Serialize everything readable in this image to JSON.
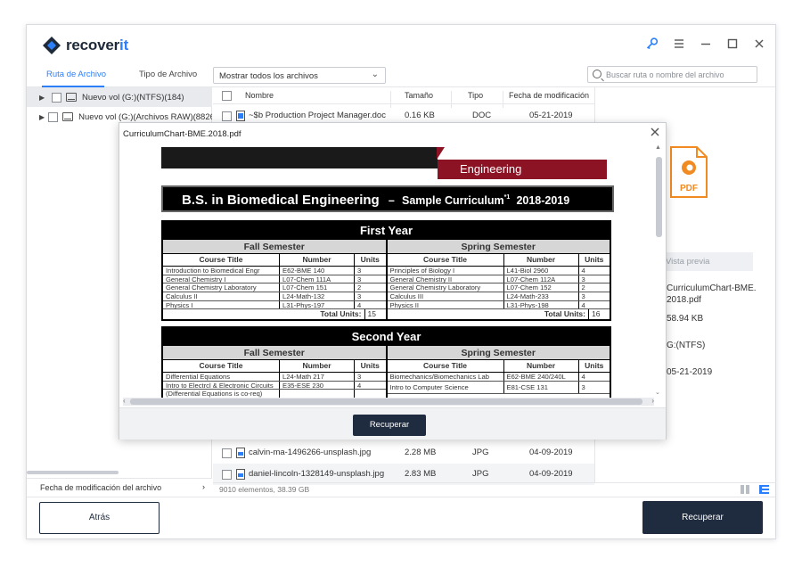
{
  "app": {
    "brand_prefix": "recover",
    "brand_suffix": "it"
  },
  "window_controls": [
    "key-icon",
    "menu-icon",
    "minimize-icon",
    "maximize-icon",
    "close-icon"
  ],
  "tabs": {
    "path": "Ruta de Archivo",
    "type": "Tipo de Archivo"
  },
  "filter": {
    "selected": "Mostrar todos los archivos"
  },
  "search": {
    "placeholder": "Buscar ruta o nombre del archivo"
  },
  "sidebar": {
    "items": [
      {
        "label": "Nuevo vol (G:)(NTFS)(184)"
      },
      {
        "label": "Nuevo vol (G:)(Archivos RAW)(8826"
      }
    ],
    "sort_label": "Fecha de modificación del archivo"
  },
  "filelist": {
    "columns": {
      "name": "Nombre",
      "size": "Tamaño",
      "type": "Tipo",
      "date": "Fecha de modificación"
    },
    "rows_top": [
      {
        "name": "~$b Production Project Manager.doc",
        "size": "0.16  KB",
        "type": "DOC",
        "date": "05-21-2019"
      }
    ],
    "rows_bottom": [
      {
        "name": "calvin-ma-1496266-unsplash.jpg",
        "size": "2.28  MB",
        "type": "JPG",
        "date": "04-09-2019"
      },
      {
        "name": "daniel-lincoln-1328149-unsplash.jpg",
        "size": "2.83  MB",
        "type": "JPG",
        "date": "04-09-2019"
      }
    ],
    "status": "9010 elementos, 38.39  GB"
  },
  "preview_pane": {
    "button": "Vista previa",
    "name": "CurriculumChart-BME.\n2018.pdf",
    "size": "58.94  KB",
    "path": "G:(NTFS)",
    "date": "05-21-2019",
    "file_icon_label": "PDF"
  },
  "footer": {
    "back": "Atrás",
    "recover": "Recuperar"
  },
  "dialog": {
    "title": "CurriculumChart-BME.2018.pdf",
    "recover": "Recuperar",
    "pdf": {
      "banner": "Engineering",
      "title_main": "B.S. in Biomedical Engineering",
      "title_dash": "–",
      "title_sub": "Sample Curriculum",
      "title_sup": "*1",
      "title_years": "2018-2019",
      "years": [
        {
          "name": "First Year",
          "semesters": [
            {
              "name": "Fall Semester",
              "head": [
                "Course Title",
                "Number",
                "Units"
              ],
              "rows": [
                [
                  "Introduction to Biomedical Engr",
                  "E62-BME 140",
                  "3"
                ],
                [
                  "General Chemistry I",
                  "L07-Chem 111A",
                  "3"
                ],
                [
                  "General Chemistry Laboratory",
                  "L07-Chem 151",
                  "2"
                ],
                [
                  "Calculus II",
                  "L24-Math-132",
                  "3"
                ],
                [
                  "Physics I",
                  "L31-Phys-197",
                  "4"
                ]
              ],
              "total_label": "Total Units:",
              "total": "15"
            },
            {
              "name": "Spring Semester",
              "head": [
                "Course Title",
                "Number",
                "Units"
              ],
              "rows": [
                [
                  "Principles of Biology I",
                  "L41-Biol 2960",
                  "4"
                ],
                [
                  "General Chemistry II",
                  "L07-Chem 112A",
                  "3"
                ],
                [
                  "General Chemistry Laboratory",
                  "L07-Chem 152",
                  "2"
                ],
                [
                  "Calculus III",
                  "L24-Math-233",
                  "3"
                ],
                [
                  "Physics II",
                  "L31-Phys-198",
                  "4"
                ]
              ],
              "total_label": "Total Units:",
              "total": "16"
            }
          ]
        },
        {
          "name": "Second Year",
          "semesters": [
            {
              "name": "Fall Semester",
              "head": [
                "Course Title",
                "Number",
                "Units"
              ],
              "rows": [
                [
                  "Differential Equations",
                  "L24-Math 217",
                  "3"
                ],
                [
                  "Intro to Electrcl & Electronic Circuits",
                  "E35-ESE 230",
                  "4"
                ],
                [
                  "(Differential Equations is co-req)",
                  "",
                  ""
                ]
              ]
            },
            {
              "name": "Spring Semester",
              "head": [
                "Course Title",
                "Number",
                "Units"
              ],
              "rows": [
                [
                  "Biomechanics/Biomechanics Lab",
                  "E62-BME 240/240L",
                  "4"
                ],
                [
                  "Intro to Computer Science",
                  "E81-CSE 131",
                  "3"
                ]
              ]
            }
          ]
        }
      ]
    }
  },
  "colors": {
    "accent": "#2d7ff9",
    "dark": "#1f2b3e",
    "pdf_orange": "#f28a22",
    "engineering_red": "#8b1324"
  }
}
